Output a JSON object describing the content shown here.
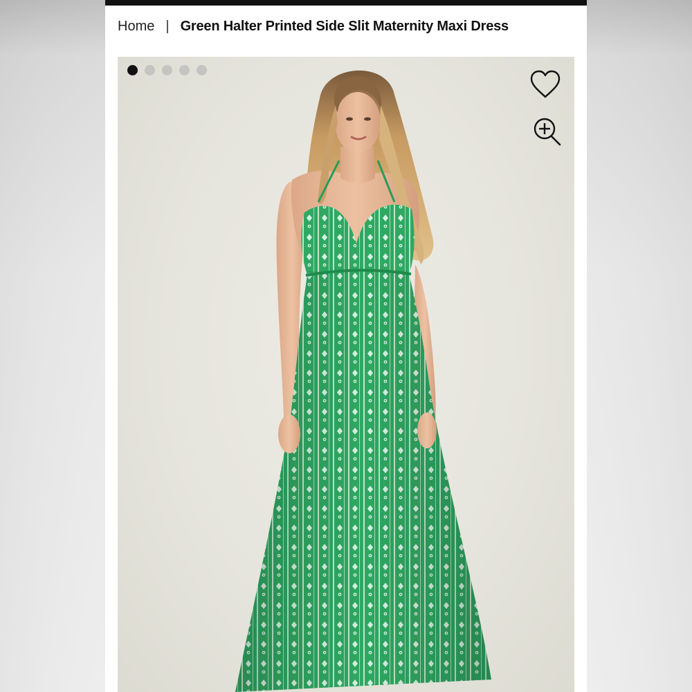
{
  "breadcrumb": {
    "home": "Home",
    "separator": "|",
    "current": "Green Halter Printed Side Slit Maternity Maxi Dress"
  },
  "gallery": {
    "slide_count": 5,
    "active_slide": 1,
    "background_color": "#e6e5dd"
  },
  "icons": {
    "favorite": "heart-icon",
    "zoom": "zoom-in-icon"
  },
  "colors": {
    "dress": "#2fa862",
    "dress_dark": "#1f8a4c",
    "pattern": "#cfeedd",
    "active_dot": "#111111",
    "inactive_dot": "#c4c4c1",
    "top_bar": "#111111"
  }
}
